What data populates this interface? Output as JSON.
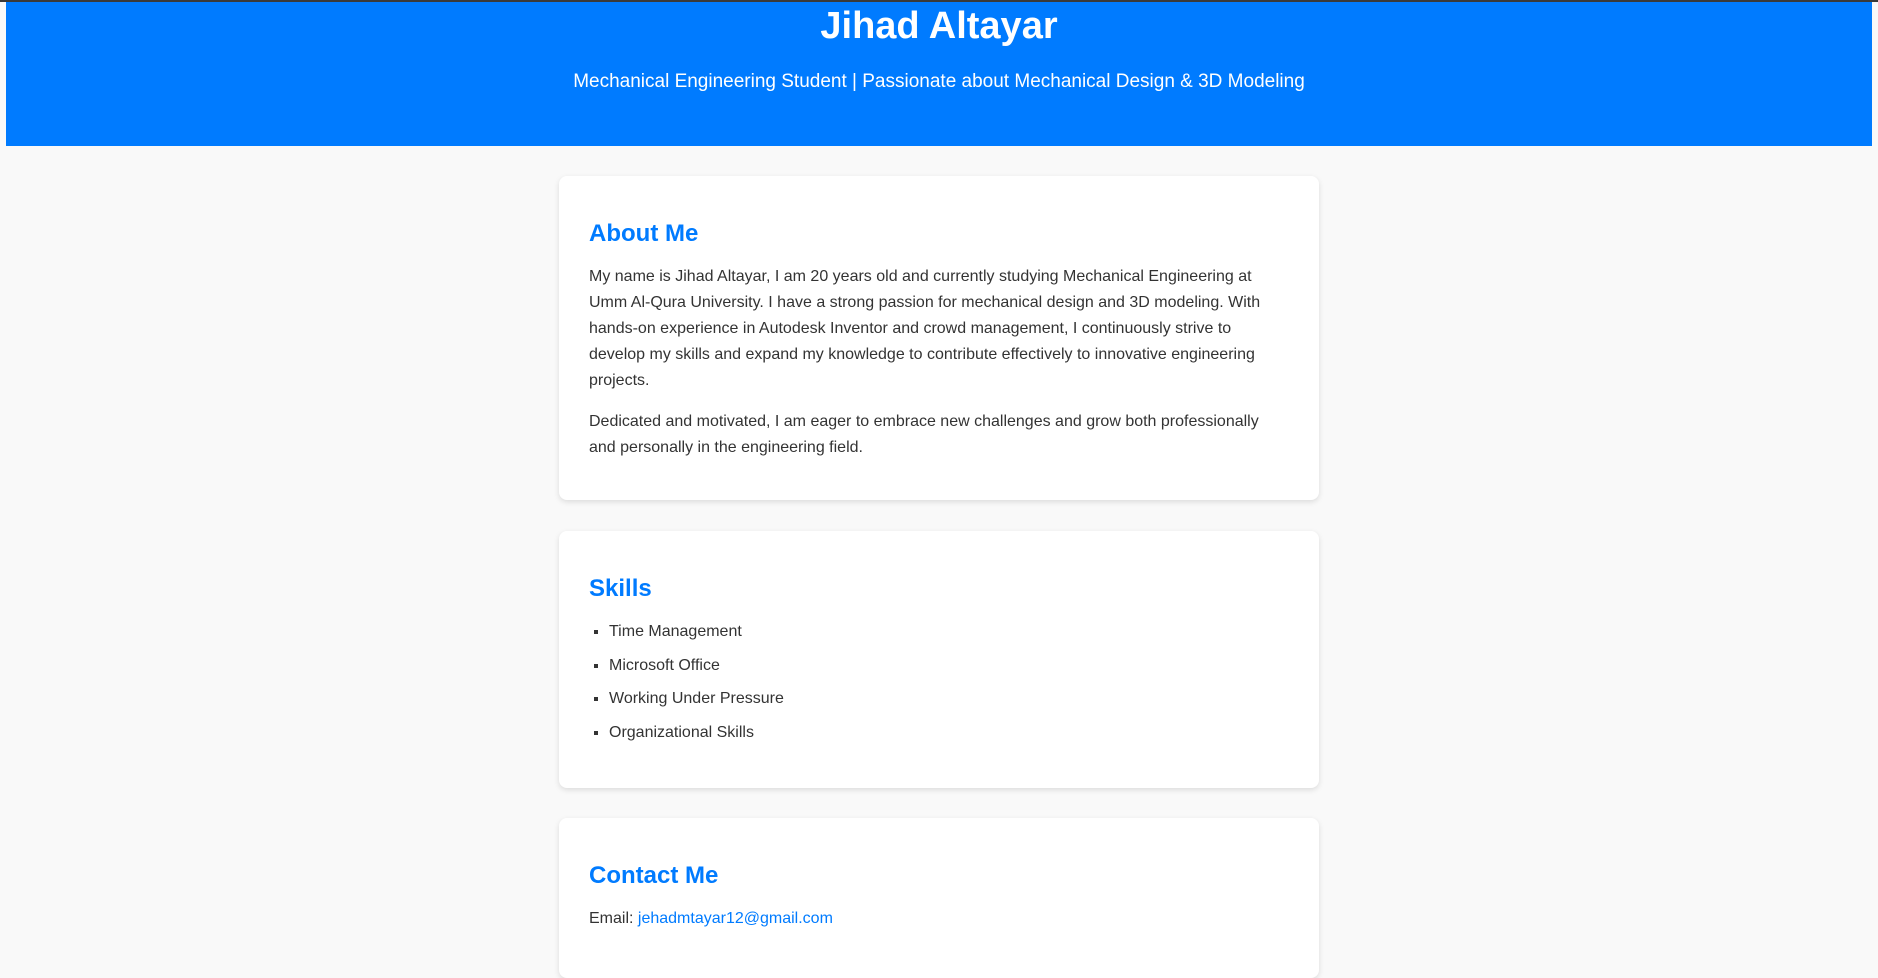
{
  "header": {
    "name": "Jihad Altayar",
    "tagline": "Mechanical Engineering Student | Passionate about Mechanical Design & 3D Modeling"
  },
  "about": {
    "title": "About Me",
    "paragraphs": [
      "My name is Jihad Altayar, I am 20 years old and currently studying Mechanical Engineering at Umm Al-Qura University. I have a strong passion for mechanical design and 3D modeling. With hands-on experience in Autodesk Inventor and crowd management, I continuously strive to develop my skills and expand my knowledge to contribute effectively to innovative engineering projects.",
      "Dedicated and motivated, I am eager to embrace new challenges and grow both professionally and personally in the engineering field."
    ]
  },
  "skills": {
    "title": "Skills",
    "items": [
      "Time Management",
      "Microsoft Office",
      "Working Under Pressure",
      "Organizational Skills"
    ]
  },
  "contact": {
    "title": "Contact Me",
    "email_label": "Email:",
    "email": "jehadmtayar12@gmail.com"
  },
  "colors": {
    "accent": "#007bff",
    "background": "#f9f9f9",
    "card": "#ffffff",
    "text": "#333333"
  }
}
